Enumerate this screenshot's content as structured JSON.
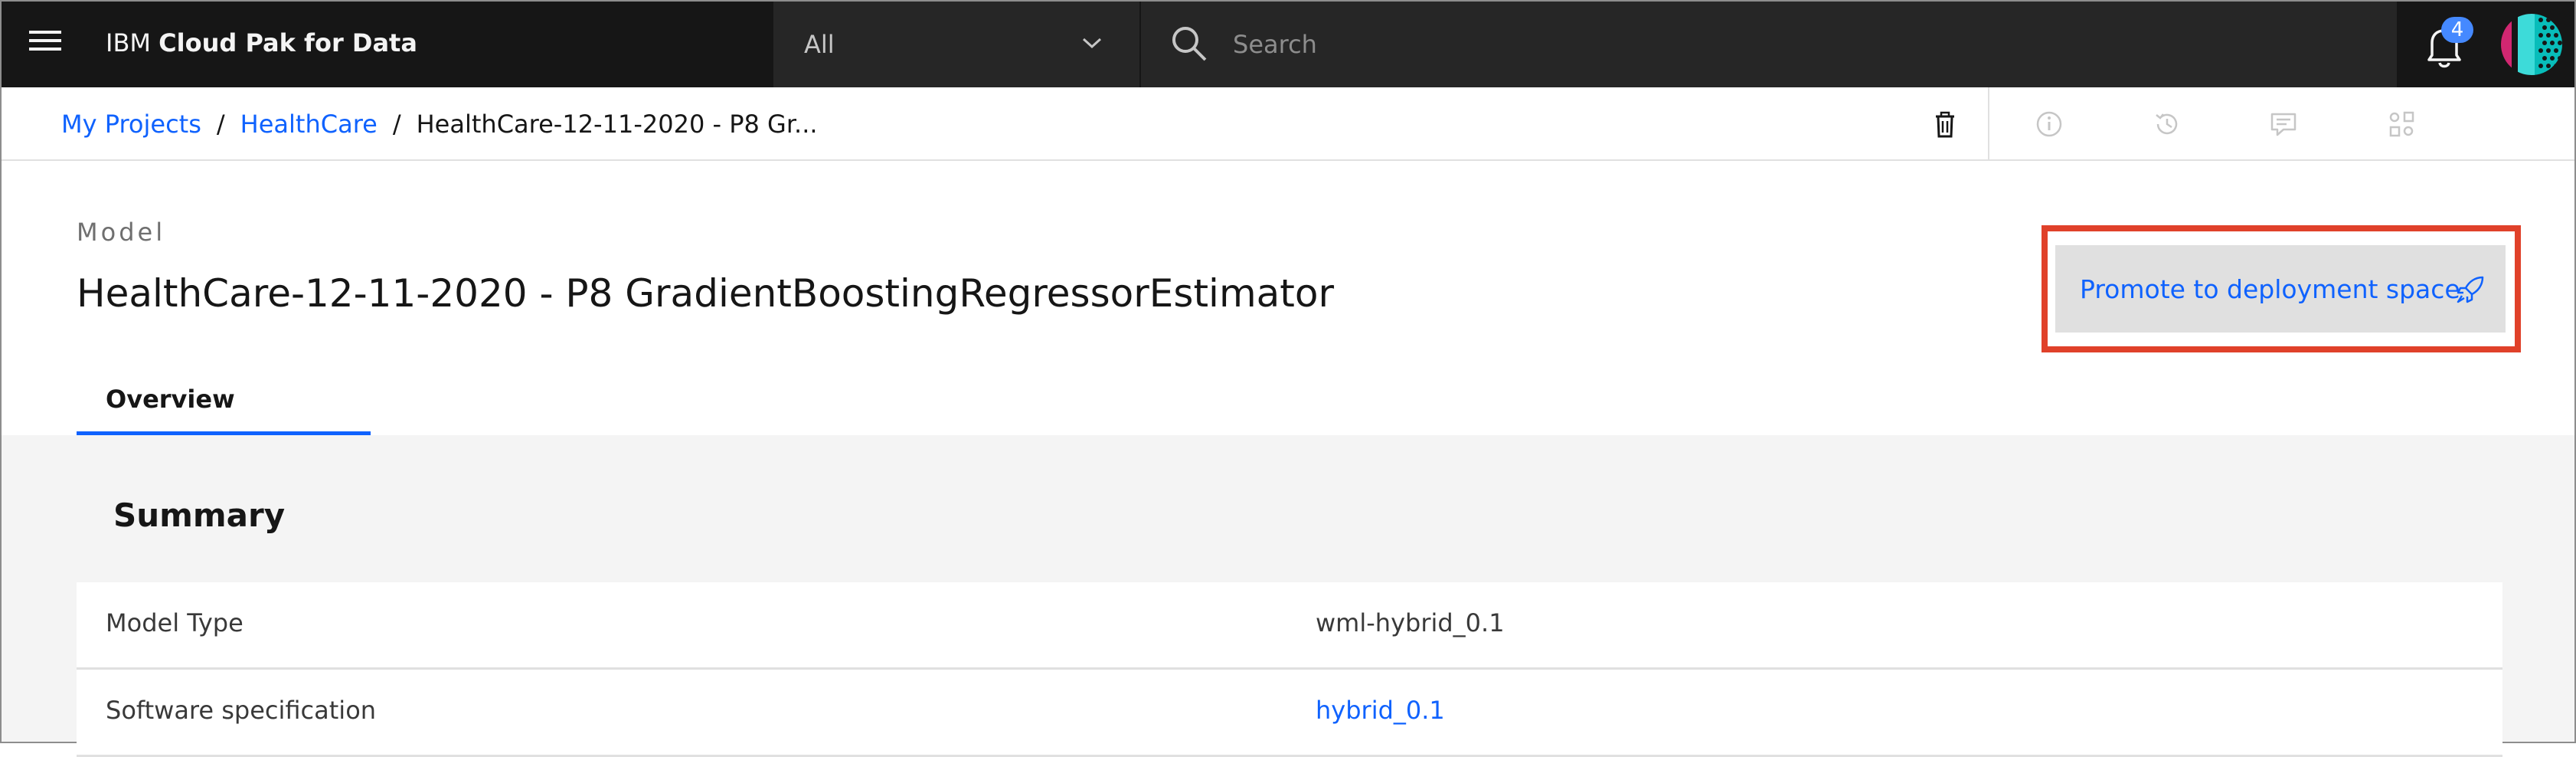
{
  "topbar": {
    "brand_prefix": "IBM",
    "brand_name": "Cloud Pak for Data",
    "scope_selected": "All",
    "search_placeholder": "Search",
    "notification_count": "4"
  },
  "breadcrumb": {
    "items": [
      "My Projects",
      "HealthCare"
    ],
    "separator": "/",
    "current": "HealthCare-12-11-2020 - P8 Gr..."
  },
  "toolbar": {
    "icons": [
      "delete-icon",
      "information-icon",
      "history-icon",
      "comment-icon",
      "apps-icon"
    ]
  },
  "header": {
    "kind": "Model",
    "title": "HealthCare-12-11-2020 - P8 GradientBoostingRegressorEstimator",
    "promote_label": "Promote to deployment space"
  },
  "tabs": [
    {
      "label": "Overview",
      "active": true
    }
  ],
  "summary": {
    "title": "Summary",
    "rows": [
      {
        "key": "Model Type",
        "value": "wml-hybrid_0.1"
      },
      {
        "key": "Software specification",
        "value": "hybrid_0.1"
      }
    ]
  },
  "colors": {
    "accent": "#0f62fe",
    "topbar": "#161616",
    "highlight": "#e0412a",
    "badge": "#4589ff"
  }
}
